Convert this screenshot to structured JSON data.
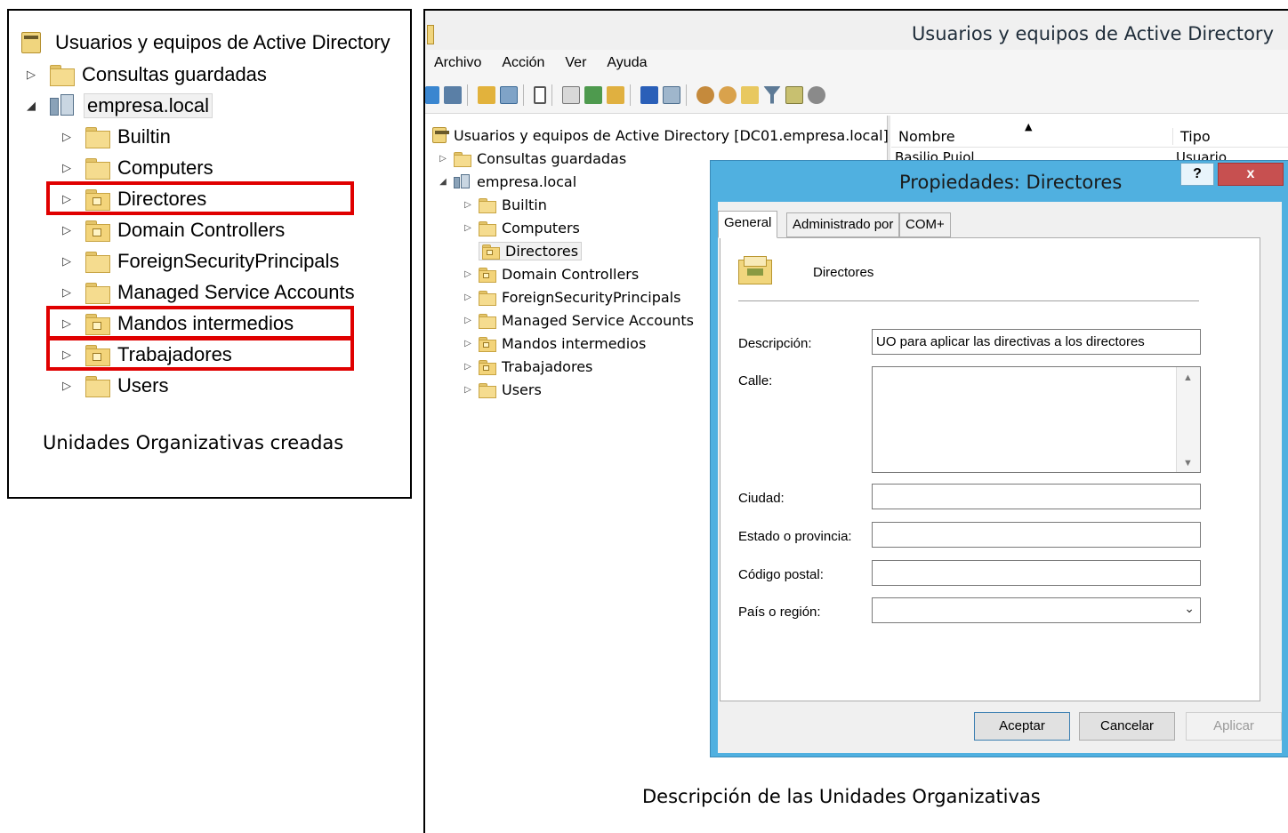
{
  "left_panel": {
    "root_label": "Usuarios y equipos de Active Directory",
    "saved_queries": "Consultas guardadas",
    "domain": "empresa.local",
    "children": [
      "Builtin",
      "Computers",
      "Directores",
      "Domain Controllers",
      "ForeignSecurityPrincipals",
      "Managed Service Accounts",
      "Mandos intermedios",
      "Trabajadores",
      "Users"
    ],
    "caption": "Unidades Organizativas creadas",
    "highlight_color": "#e00000"
  },
  "window": {
    "title": "Usuarios y equipos de Active Directory",
    "menu": [
      "Archivo",
      "Acción",
      "Ver",
      "Ayuda"
    ]
  },
  "tree": {
    "root_label": "Usuarios y equipos de Active Directory [DC01.empresa.local]",
    "saved_queries": "Consultas guardadas",
    "domain": "empresa.local",
    "children": [
      "Builtin",
      "Computers",
      "Directores",
      "Domain Controllers",
      "ForeignSecurityPrincipals",
      "Managed Service Accounts",
      "Mandos intermedios",
      "Trabajadores",
      "Users"
    ],
    "selected": "Directores"
  },
  "list": {
    "col_name": "Nombre",
    "col_type": "Tipo",
    "first_row_name": "Basilio Pujol",
    "first_row_type": "Usuario"
  },
  "dialog": {
    "title": "Propiedades: Directores",
    "help": "?",
    "close": "x",
    "tabs": [
      "General",
      "Administrado por",
      "COM+"
    ],
    "ou_name": "Directores",
    "fields": {
      "descripcion_label": "Descripción:",
      "descripcion_value": "UO para aplicar las directivas a los directores",
      "calle_label": "Calle:",
      "ciudad_label": "Ciudad:",
      "estado_label": "Estado o provincia:",
      "codigo_label": "Código postal:",
      "pais_label": "País o región:"
    },
    "buttons": {
      "ok": "Aceptar",
      "cancel": "Cancelar",
      "apply": "Aplicar"
    },
    "accent_color": "#50b0e0"
  },
  "right_caption": "Descripción de las Unidades Organizativas"
}
